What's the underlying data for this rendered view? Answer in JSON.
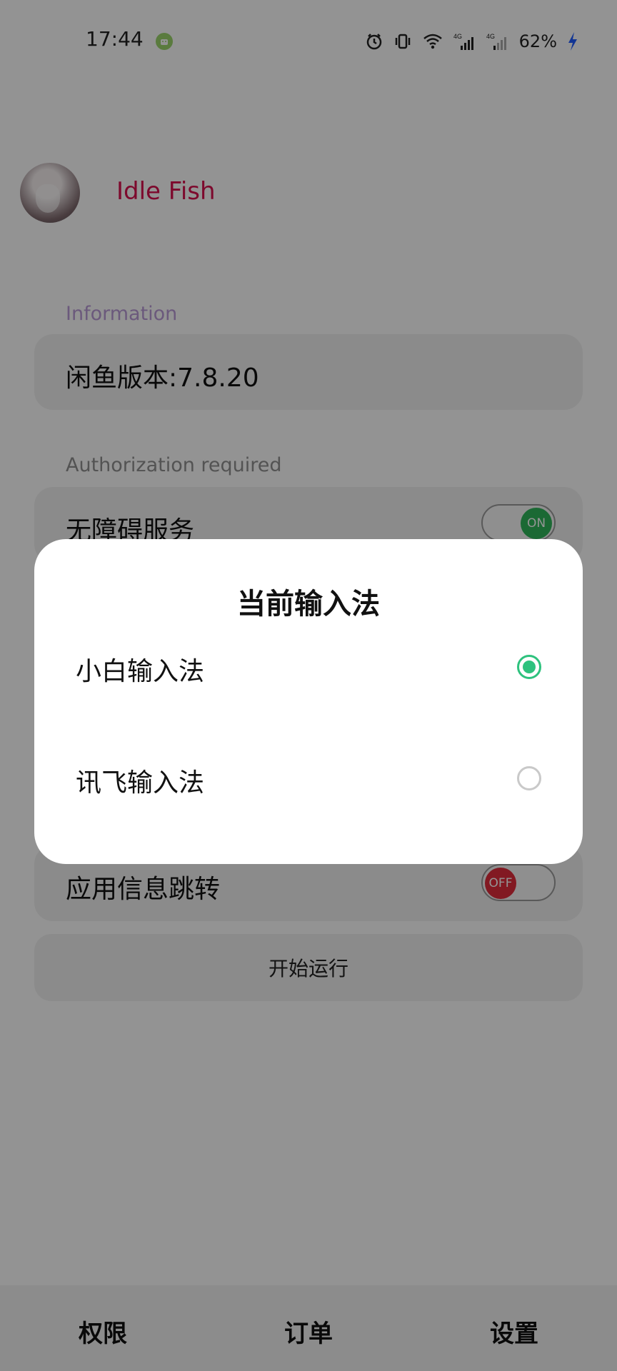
{
  "status_bar": {
    "time": "17:44",
    "app_icon": "android-notification-icon",
    "icons": [
      "alarm-icon",
      "vibrate-icon",
      "wifi-icon",
      "signal-4g-icon",
      "signal-4g-icon"
    ],
    "signal_label": "4G",
    "battery": "62%",
    "charging_icon": "lightning-icon",
    "accent_colors": {
      "charging": "#1f5cff"
    }
  },
  "profile": {
    "name": "Idle Fish",
    "avatar_icon": "avatar-image",
    "name_color": "#d8114f"
  },
  "sections": {
    "information_label": "Information",
    "version_text": "闲鱼版本:7.8.20",
    "authorization_label": "Authorization required",
    "accessibility_service": "无障碍服务",
    "accessibility_toggle": "ON",
    "app_info_jump": "应用信息跳转",
    "app_info_toggle": "OFF",
    "start_button": "开始运行"
  },
  "dialog": {
    "title": "当前输入法",
    "options": [
      {
        "label": "小白输入法",
        "selected": true
      },
      {
        "label": "讯飞输入法",
        "selected": false
      }
    ],
    "accent_color": "#2ec27e"
  },
  "bottom_nav": {
    "items": [
      "权限",
      "订单",
      "设置"
    ]
  }
}
